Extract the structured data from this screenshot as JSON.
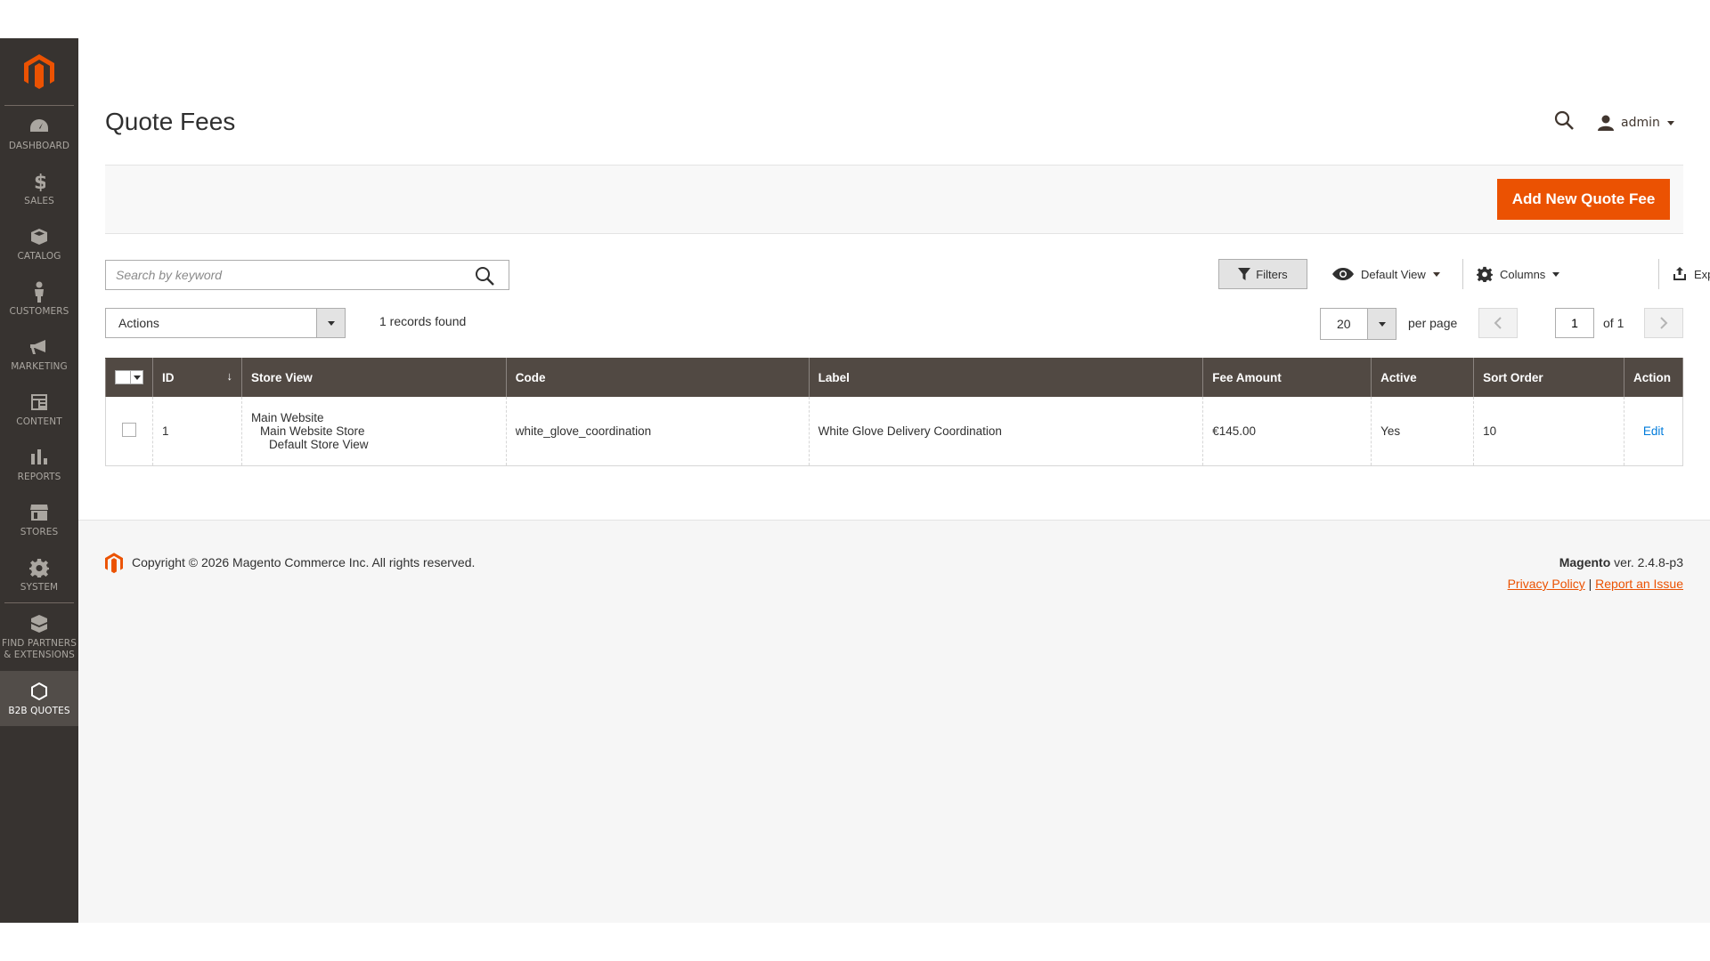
{
  "sidebar": {
    "items": [
      {
        "label": "DASHBOARD",
        "icon": "dashboard-icon"
      },
      {
        "label": "SALES",
        "icon": "dollar-icon"
      },
      {
        "label": "CATALOG",
        "icon": "box-icon"
      },
      {
        "label": "CUSTOMERS",
        "icon": "person-icon"
      },
      {
        "label": "MARKETING",
        "icon": "megaphone-icon"
      },
      {
        "label": "CONTENT",
        "icon": "content-icon"
      },
      {
        "label": "REPORTS",
        "icon": "bar-chart-icon"
      },
      {
        "label": "STORES",
        "icon": "store-icon"
      },
      {
        "label": "SYSTEM",
        "icon": "gear-icon"
      },
      {
        "label_line1": "FIND PARTNERS",
        "label_line2": "& EXTENSIONS",
        "icon": "boxes-icon"
      },
      {
        "label": "B2B QUOTES",
        "icon": "hexagon-icon"
      }
    ]
  },
  "header": {
    "title": "Quote Fees",
    "user": "admin"
  },
  "action_bar": {
    "add_button": "Add New Quote Fee"
  },
  "toolbar": {
    "search_placeholder": "Search by keyword",
    "filters": "Filters",
    "view": "Default View",
    "columns": "Columns",
    "export": "Export",
    "actions": "Actions",
    "records_found": "1 records found",
    "per_page_value": "20",
    "per_page_label": "per page",
    "page_value": "1",
    "page_of": "of 1"
  },
  "grid": {
    "columns": [
      "ID",
      "Store View",
      "Code",
      "Label",
      "Fee Amount",
      "Active",
      "Sort Order",
      "Action"
    ],
    "rows": [
      {
        "id": "1",
        "store_view_1": "Main Website",
        "store_view_2": "Main Website Store",
        "store_view_3": "Default Store View",
        "code": "white_glove_coordination",
        "label": "White Glove Delivery Coordination",
        "fee_amount": "€145.00",
        "active": "Yes",
        "sort_order": "10",
        "action": "Edit"
      }
    ]
  },
  "footer": {
    "copyright": "Copyright © 2026 Magento Commerce Inc. All rights reserved.",
    "brand": "Magento",
    "version": "ver. 2.4.8-p3",
    "privacy": "Privacy Policy",
    "separator": "|",
    "report": "Report an Issue"
  },
  "colors": {
    "accent": "#eb5202",
    "sidebar": "#373330",
    "grid_header": "#514943",
    "link": "#007bdb"
  }
}
